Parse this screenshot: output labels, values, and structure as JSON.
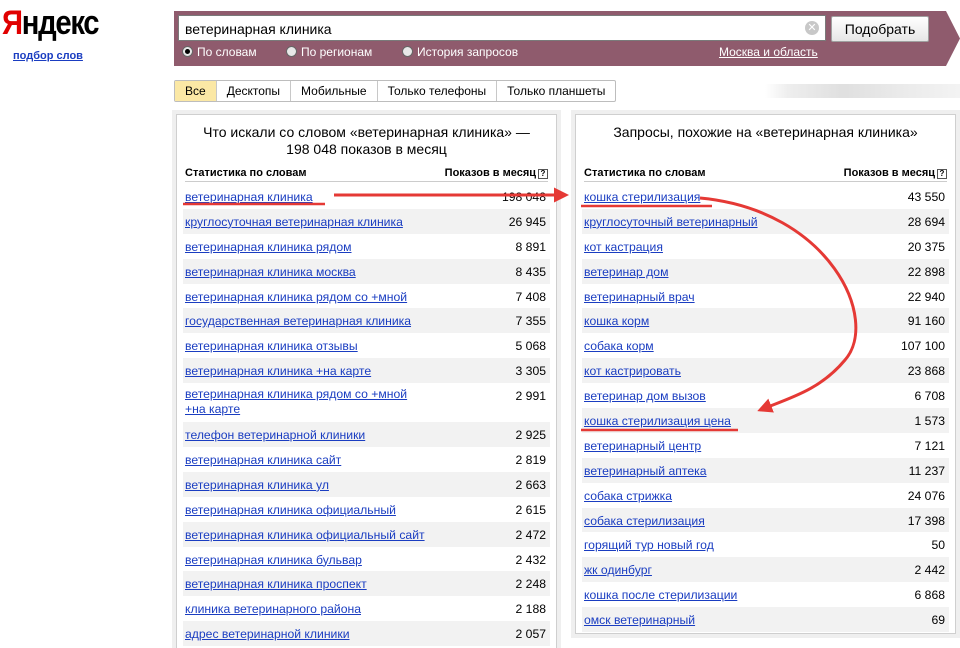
{
  "header": {
    "logo_first": "Я",
    "logo_rest": "ндекс",
    "logo_sub": "подбор слов"
  },
  "search": {
    "query": "ветеринарная клиника",
    "submit_label": "Подобрать",
    "clear_icon": "✕",
    "modes": [
      {
        "label": "По словам",
        "selected": true
      },
      {
        "label": "По регионам",
        "selected": false
      },
      {
        "label": "История запросов",
        "selected": false
      }
    ],
    "region": "Москва и область"
  },
  "tabs": [
    {
      "label": "Все",
      "active": true
    },
    {
      "label": "Десктопы",
      "active": false
    },
    {
      "label": "Мобильные",
      "active": false
    },
    {
      "label": "Только телефоны",
      "active": false
    },
    {
      "label": "Только планшеты",
      "active": false
    }
  ],
  "left": {
    "title": "Что искали со словом «ветеринарная клиника» — 198 048 показов в месяц",
    "col_keyword": "Статистика по словам",
    "col_count": "Показов в месяц",
    "help_icon": "?",
    "rows": [
      {
        "kw": "ветеринарная клиника",
        "count": "198 048"
      },
      {
        "kw": "круглосуточная ветеринарная клиника",
        "count": "26 945"
      },
      {
        "kw": "ветеринарная клиника рядом",
        "count": "8 891"
      },
      {
        "kw": "ветеринарная клиника москва",
        "count": "8 435"
      },
      {
        "kw": "ветеринарная клиника рядом со +мной",
        "count": "7 408"
      },
      {
        "kw": "государственная ветеринарная клиника",
        "count": "7 355"
      },
      {
        "kw": "ветеринарная клиника отзывы",
        "count": "5 068"
      },
      {
        "kw": "ветеринарная клиника +на карте",
        "count": "3 305"
      },
      {
        "kw": "ветеринарная клиника рядом со +мной +на карте",
        "count": "2 991"
      },
      {
        "kw": "телефон ветеринарной клиники",
        "count": "2 925"
      },
      {
        "kw": "ветеринарная клиника сайт",
        "count": "2 819"
      },
      {
        "kw": "ветеринарная клиника ул",
        "count": "2 663"
      },
      {
        "kw": "ветеринарная клиника официальный",
        "count": "2 615"
      },
      {
        "kw": "ветеринарная клиника официальный сайт",
        "count": "2 472"
      },
      {
        "kw": "ветеринарная клиника бульвар",
        "count": "2 432"
      },
      {
        "kw": "ветеринарная клиника проспект",
        "count": "2 248"
      },
      {
        "kw": "клиника ветеринарного района",
        "count": "2 188"
      },
      {
        "kw": "адрес ветеринарной клиники",
        "count": "2 057"
      }
    ]
  },
  "right": {
    "title": "Запросы, похожие на «ветеринарная клиника»",
    "col_keyword": "Статистика по словам",
    "col_count": "Показов в месяц",
    "help_icon": "?",
    "rows": [
      {
        "kw": "кошка стерилизация",
        "count": "43 550"
      },
      {
        "kw": "круглосуточный ветеринарный",
        "count": "28 694"
      },
      {
        "kw": "кот кастрация",
        "count": "20 375"
      },
      {
        "kw": "ветеринар дом",
        "count": "22 898"
      },
      {
        "kw": "ветеринарный врач",
        "count": "22 940"
      },
      {
        "kw": "кошка корм",
        "count": "91 160"
      },
      {
        "kw": "собака корм",
        "count": "107 100"
      },
      {
        "kw": "кот кастрировать",
        "count": "23 868"
      },
      {
        "kw": "ветеринар дом вызов",
        "count": "6 708"
      },
      {
        "kw": "кошка стерилизация цена",
        "count": "1 573"
      },
      {
        "kw": "ветеринарный центр",
        "count": "7 121"
      },
      {
        "kw": "ветеринарный аптека",
        "count": "11 237"
      },
      {
        "kw": "собака стрижка",
        "count": "24 076"
      },
      {
        "kw": "собака стерилизация",
        "count": "17 398"
      },
      {
        "kw": "горящий тур новый год",
        "count": "50"
      },
      {
        "kw": "жк одинбург",
        "count": "2 442"
      },
      {
        "kw": "кошка после стерилизации",
        "count": "6 868"
      },
      {
        "kw": "омск ветеринарный",
        "count": "69"
      }
    ]
  },
  "annotation_color": "#e53935"
}
